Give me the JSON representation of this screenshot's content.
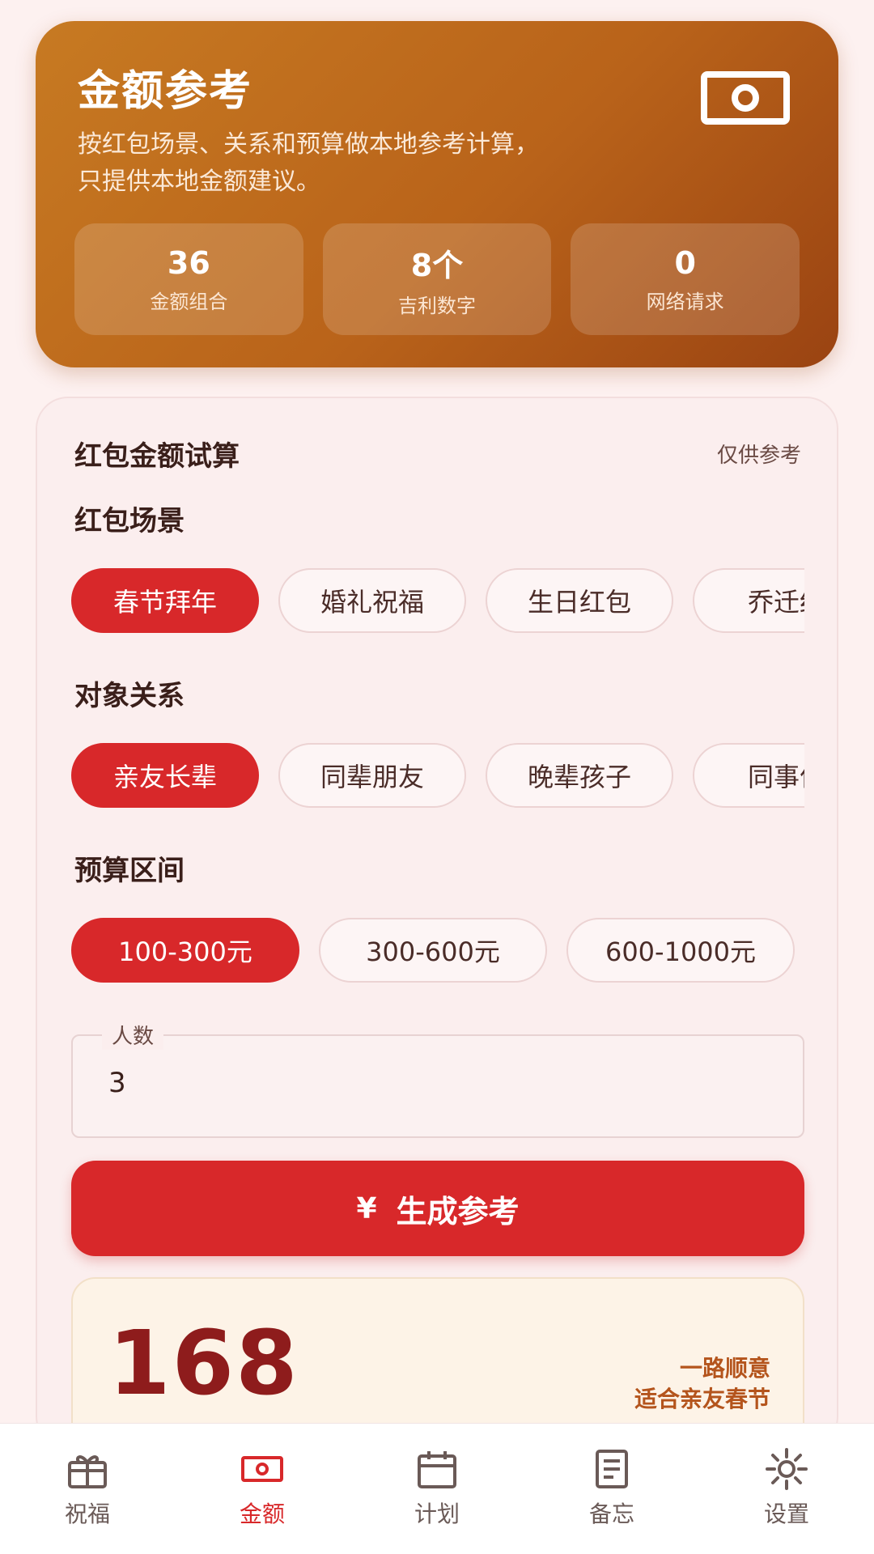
{
  "hero": {
    "title": "金额参考",
    "desc_line1": "按红包场景、关系和预算做本地参考计算，",
    "desc_line2": "只提供本地金额建议。",
    "icon": "money-bill-icon",
    "stats": [
      {
        "value": "36",
        "label": "金额组合"
      },
      {
        "value": "8个",
        "label": "吉利数字"
      },
      {
        "value": "0",
        "label": "网络请求"
      }
    ]
  },
  "calc": {
    "title": "红包金额试算",
    "note": "仅供参考",
    "scene_label": "红包场景",
    "scenes": [
      "春节拜年",
      "婚礼祝福",
      "生日红包",
      "乔迁红"
    ],
    "relation_label": "对象关系",
    "relations": [
      "亲友长辈",
      "同辈朋友",
      "晚辈孩子",
      "同事伙"
    ],
    "budget_label": "预算区间",
    "budgets": [
      "100-300元",
      "300-600元",
      "600-1000元"
    ],
    "people_label": "人数",
    "people_value": "3",
    "generate_icon": "¥",
    "generate_label": "生成参考",
    "result_amount": "168",
    "result_tag1": "一路顺意",
    "result_tag2": "适合亲友春节"
  },
  "nav": {
    "items": [
      {
        "label": "祝福",
        "icon": "gift-icon"
      },
      {
        "label": "金额",
        "icon": "money-bill-icon"
      },
      {
        "label": "计划",
        "icon": "calendar-icon"
      },
      {
        "label": "备忘",
        "icon": "note-icon"
      },
      {
        "label": "设置",
        "icon": "settings-icon"
      }
    ]
  },
  "colors": {
    "accent": "#d8282a",
    "hero": "#b9631a",
    "amount": "#8e1c1c"
  }
}
